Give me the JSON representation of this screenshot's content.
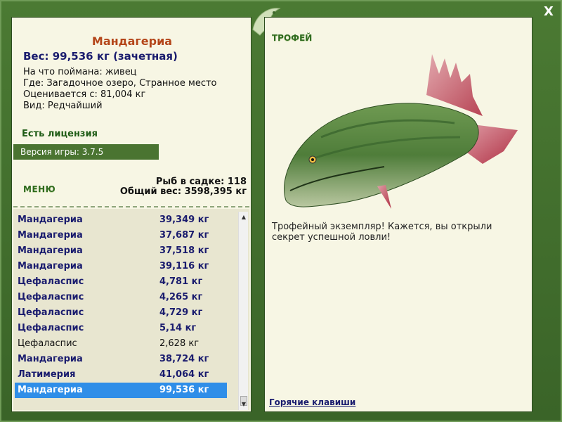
{
  "window": {
    "close_label": "X"
  },
  "fish": {
    "name": "Мандагериа",
    "weight_line": "Вес: 99,536 кг (зачетная)",
    "caught_on": "На что поймана: живец",
    "location": "Где: Загадочное озеро, Странное место",
    "rated_from": "Оценивается с: 81,004 кг",
    "species": "Вид: Редчайший"
  },
  "license": "Есть лицензия",
  "version": "Версия игры: 3.7.5",
  "menu_label": "МЕНЮ",
  "stats": {
    "fish_count": "Рыб в садке: 118",
    "total_weight": "Общий вес: 3598,395 кг"
  },
  "catch_list": [
    {
      "name": "Мандагериа",
      "weight": "39,349 кг",
      "trophy": true
    },
    {
      "name": "Мандагериа",
      "weight": "37,687 кг",
      "trophy": true
    },
    {
      "name": "Мандагериа",
      "weight": "37,518 кг",
      "trophy": true
    },
    {
      "name": "Мандагериа",
      "weight": "39,116 кг",
      "trophy": true
    },
    {
      "name": "Цефаласпис",
      "weight": "4,781 кг",
      "trophy": true
    },
    {
      "name": "Цефаласпис",
      "weight": "4,265 кг",
      "trophy": true
    },
    {
      "name": "Цефаласпис",
      "weight": "4,729 кг",
      "trophy": true
    },
    {
      "name": "Цефаласпис",
      "weight": "5,14 кг",
      "trophy": true
    },
    {
      "name": "Цефаласпис",
      "weight": "2,628 кг",
      "trophy": false
    },
    {
      "name": "Мандагериа",
      "weight": "38,724 кг",
      "trophy": true
    },
    {
      "name": "Латимерия",
      "weight": "41,064 кг",
      "trophy": true
    },
    {
      "name": "Мандагериа",
      "weight": "99,536 кг",
      "trophy": true,
      "selected": true
    }
  ],
  "trophy": {
    "label": "ТРОФЕЙ",
    "description": "Трофейный экземпляр! Кажется, вы открыли секрет успешной ловли!"
  },
  "hotkeys_label": "Горячие клавиши",
  "colors": {
    "frame": "#3f6a2c",
    "panel": "#f7f6e4",
    "title": "#b4461a",
    "trophy_text": "#1a1c6e",
    "selected_row": "#2f8ee8"
  },
  "icons": [
    "fish-logo-icon",
    "close-icon",
    "scroll-up-icon",
    "scroll-down-icon"
  ]
}
